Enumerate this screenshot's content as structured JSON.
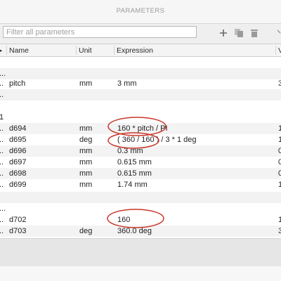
{
  "window": {
    "title": "PARAMETERS"
  },
  "toolbar": {
    "filter_placeholder": "Filter all parameters",
    "add_icon": "plus-icon",
    "copy_icon": "copy-icon",
    "delete_icon": "trash-icon"
  },
  "columns": {
    "name": "Name",
    "unit": "Unit",
    "expression": "Expression",
    "value": "V"
  },
  "rows": [
    {
      "kind": "blank",
      "c0": "",
      "name": "",
      "unit": "",
      "expr": "",
      "value": ""
    },
    {
      "kind": "group",
      "c0": "...",
      "name": "",
      "unit": "",
      "expr": "",
      "value": ""
    },
    {
      "kind": "data",
      "c0": "..",
      "name": "pitch",
      "unit": "mm",
      "expr": "3 mm",
      "value": "3"
    },
    {
      "kind": "group",
      "c0": "..",
      "name": "",
      "unit": "",
      "expr": "",
      "value": ""
    },
    {
      "kind": "blank",
      "c0": "",
      "name": "",
      "unit": "",
      "expr": "",
      "value": ""
    },
    {
      "kind": "data",
      "c0": "1",
      "name": "",
      "unit": "",
      "expr": "",
      "value": ""
    },
    {
      "kind": "alt",
      "c0": "..",
      "name": "d694",
      "unit": "mm",
      "expr": "160 * pitch / PI",
      "value": "1"
    },
    {
      "kind": "data",
      "c0": "..",
      "name": "d695",
      "unit": "deg",
      "expr": "( 360 / 160 ) / 3 * 1 deg",
      "value": "1"
    },
    {
      "kind": "alt",
      "c0": "..",
      "name": "d696",
      "unit": "mm",
      "expr": "0.3 mm",
      "value": "0"
    },
    {
      "kind": "data",
      "c0": "..",
      "name": "d697",
      "unit": "mm",
      "expr": "0.615 mm",
      "value": "0"
    },
    {
      "kind": "alt",
      "c0": "..",
      "name": "d698",
      "unit": "mm",
      "expr": "0.615 mm",
      "value": "0"
    },
    {
      "kind": "data",
      "c0": "..",
      "name": "d699",
      "unit": "mm",
      "expr": "1.74 mm",
      "value": "1"
    },
    {
      "kind": "group",
      "c0": "",
      "name": "",
      "unit": "",
      "expr": "",
      "value": ""
    },
    {
      "kind": "blank",
      "c0": "...",
      "name": "",
      "unit": "",
      "expr": "",
      "value": ""
    },
    {
      "kind": "data",
      "c0": "..",
      "name": "d702",
      "unit": "",
      "expr": "160",
      "value": "1"
    },
    {
      "kind": "alt",
      "c0": "..",
      "name": "d703",
      "unit": "deg",
      "expr": "360.0 deg",
      "value": "3"
    }
  ],
  "annotations": {
    "color": "#c8372a",
    "shape": "ellipse"
  }
}
